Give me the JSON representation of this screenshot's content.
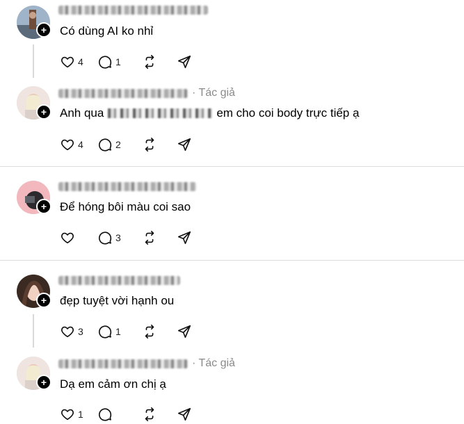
{
  "threads": [
    {
      "comment": {
        "text": "Có dùng AI ko nhỉ",
        "author_tag": "",
        "likes": "4",
        "replies": "1",
        "avatar_color": "#7a8ca3"
      },
      "reply": {
        "text_before": "Anh qua",
        "text_after": "em cho coi body trực tiếp ạ",
        "author_tag": "· Tác giả",
        "likes": "4",
        "replies": "2",
        "avatar_color": "#e9d7cf"
      }
    },
    {
      "comment": {
        "text": "Để hóng bôi màu coi sao",
        "likes": "",
        "replies": "3",
        "avatar_color": "#e8a3a8"
      }
    },
    {
      "comment": {
        "text": "đẹp tuyệt vời hạnh ou",
        "likes": "3",
        "replies": "1",
        "avatar_color": "#4a3328"
      },
      "reply": {
        "text": "Dạ em cảm ơn chị ạ",
        "author_tag": "· Tác giả",
        "likes": "1",
        "replies": "",
        "avatar_color": "#e9d7cf"
      }
    }
  ],
  "icons": {
    "like": "heart-icon",
    "reply": "comment-bubble-icon",
    "repost": "repost-icon",
    "share": "send-icon",
    "follow": "plus-icon"
  }
}
